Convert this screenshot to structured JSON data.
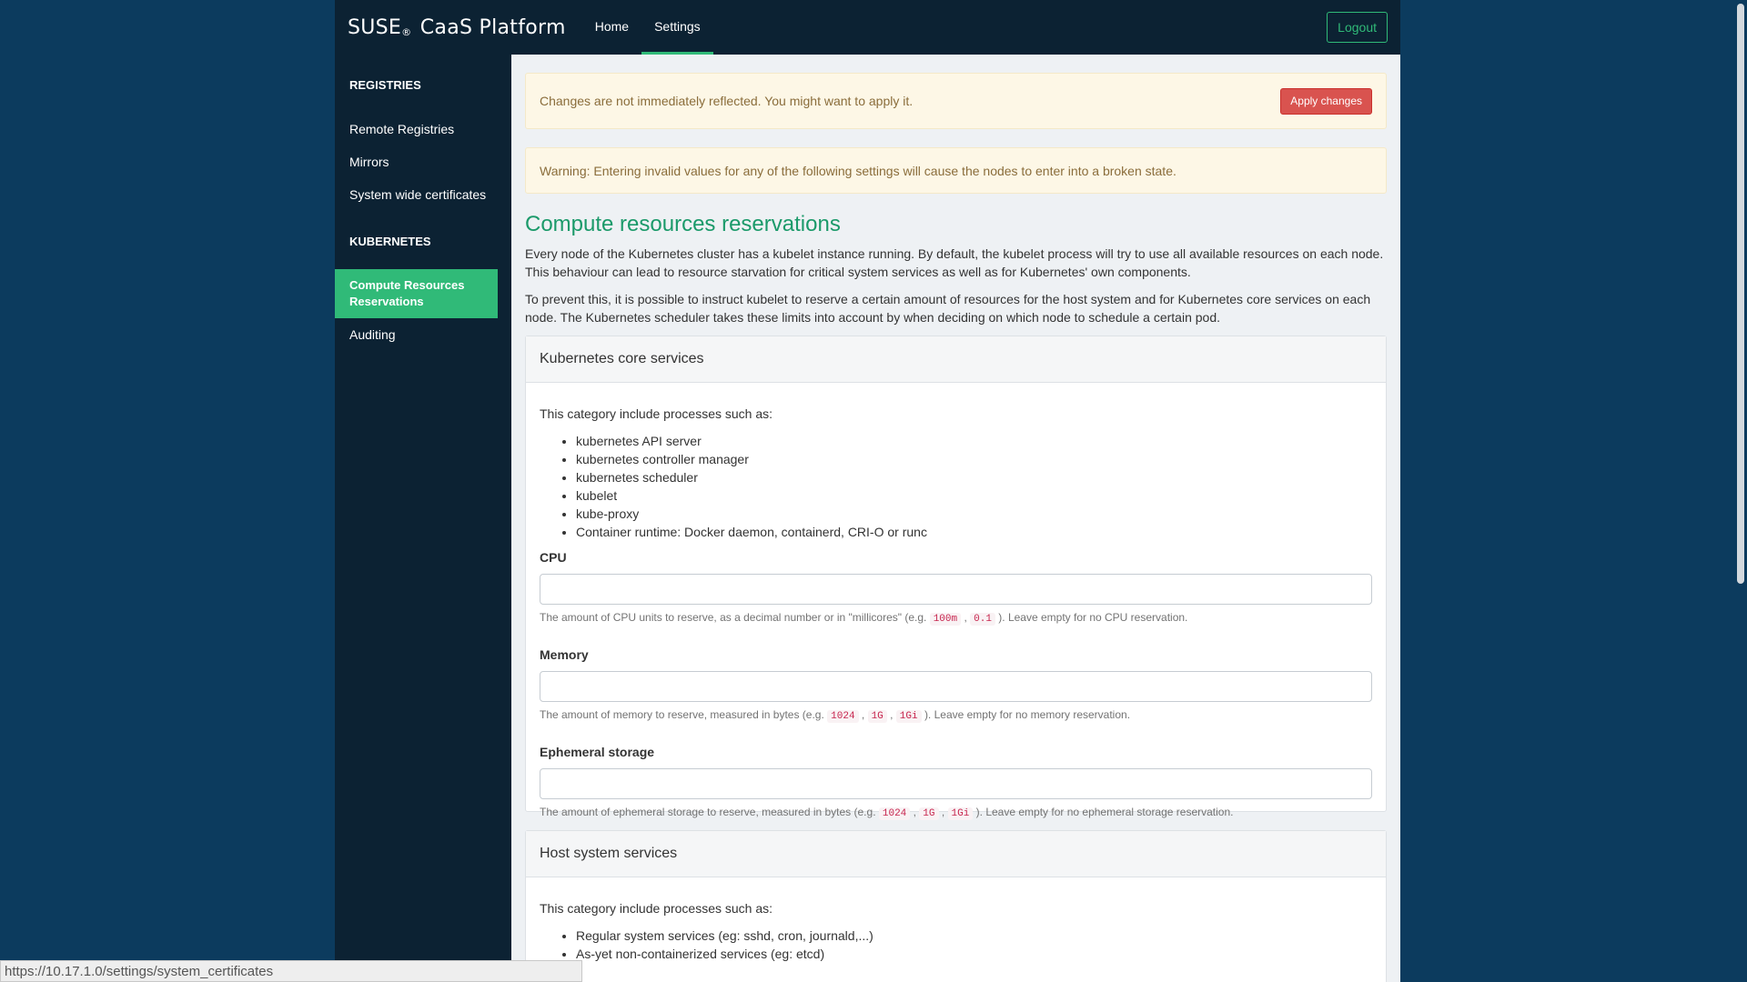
{
  "navbar": {
    "brand_main": "SUSE",
    "brand_reg": "®",
    "brand_rest": " CaaS Platform",
    "links": [
      "Home",
      "Settings"
    ],
    "logout_label": "Logout"
  },
  "sidebar": {
    "sections": [
      "REGISTRIES",
      "KUBERNETES"
    ],
    "registries_items": [
      "Remote Registries",
      "Mirrors",
      "System wide certificates"
    ],
    "kubernetes_items": [
      "Compute Resources Reservations",
      "Auditing"
    ],
    "active_item": "Compute Resources Reservations"
  },
  "alerts": {
    "apply_text": "Changes are not immediately reflected. You might want to apply it.",
    "apply_button": "Apply changes",
    "warning_text": "Warning: Entering invalid values for any of the following settings will cause the nodes to enter into a broken state."
  },
  "main": {
    "title": "Compute resources reservations",
    "para1": "Every node of the Kubernetes cluster has a kubelet instance running. By default, the kubelet process will try to use all available resources on each node. This behaviour can lead to resource starvation for critical system services as well as for Kubernetes' own components.",
    "para2": "To prevent this, it is possible to instruct kubelet to reserve a certain amount of resources for the host system and for Kubernetes core services on each node. The Kubernetes scheduler takes these limits into account by when deciding on which node to schedule a certain pod."
  },
  "core_panel": {
    "heading": "Kubernetes core services",
    "intro": "This category include processes such as:",
    "items": [
      "kubernetes API server",
      "kubernetes controller manager",
      "kubernetes scheduler",
      "kubelet",
      "kube-proxy",
      "Container runtime: Docker daemon, containerd, CRI-O or runc"
    ],
    "cpu": {
      "label": "CPU",
      "value": "",
      "help_pre": "The amount of CPU units to reserve, as a decimal number or in \"millicores\" (e.g. ",
      "codes": [
        "100m",
        "0.1"
      ],
      "help_post": "). Leave empty for no CPU reservation."
    },
    "memory": {
      "label": "Memory",
      "value": "",
      "help_pre": "The amount of memory to reserve, measured in bytes (e.g. ",
      "codes": [
        "1024",
        "1G",
        "1Gi"
      ],
      "help_post": "). Leave empty for no memory reservation."
    },
    "storage": {
      "label": "Ephemeral storage",
      "value": "",
      "help_pre": "The amount of ephemeral storage to reserve, measured in bytes (e.g. ",
      "codes": [
        "1024",
        "1G",
        "1Gi"
      ],
      "help_post": "). Leave empty for no ephemeral storage reservation."
    }
  },
  "host_panel": {
    "heading": "Host system services",
    "intro": "This category include processes such as:",
    "items": [
      "Regular system services (eg: sshd, cron, journald,...)",
      "As-yet non-containerized services (eg: etcd)"
    ]
  },
  "status_url": "https://10.17.1.0/settings/system_certificates",
  "colors": {
    "accent": "#30ba78",
    "danger": "#d9534f",
    "sidebar_bg": "#0c2233",
    "page_bg": "#0c3b5e"
  }
}
